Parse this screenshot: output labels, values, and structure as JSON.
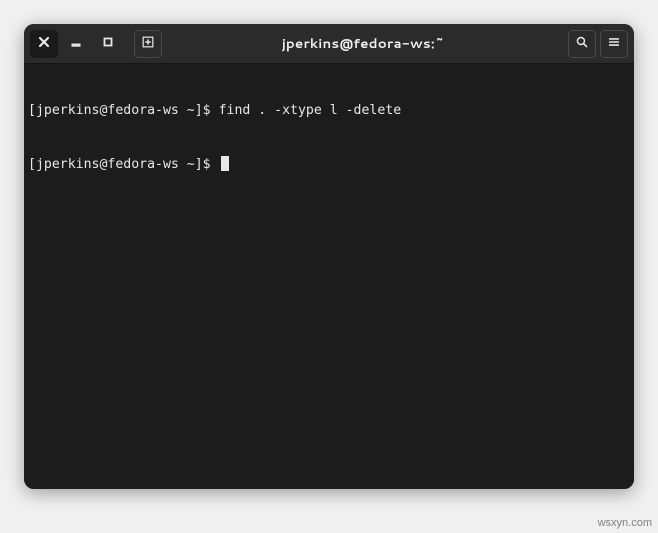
{
  "titlebar": {
    "title": "jperkins@fedora-ws:~"
  },
  "terminal": {
    "lines": [
      {
        "prompt": "[jperkins@fedora-ws ~]$ ",
        "command": "find . -xtype l -delete",
        "cursor": false
      },
      {
        "prompt": "[jperkins@fedora-ws ~]$ ",
        "command": "",
        "cursor": true
      }
    ]
  },
  "watermark": "wsxyn.com"
}
